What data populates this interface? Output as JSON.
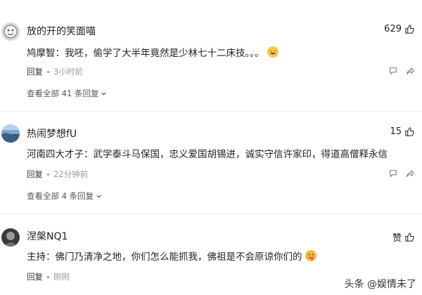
{
  "comments": [
    {
      "username": "放的开的笑面喵",
      "likes": "629",
      "text": "鸠摩智：我呸，偷学了大半年竟然是少林七十二床技。。。",
      "reply_label": "回复",
      "time": "3小时前",
      "view_all": "查看全部 41 条回复"
    },
    {
      "username": "热闹梦想fU",
      "likes": "15",
      "text": "河南四大才子：武学泰斗马保国，忠义爱国胡锡进，诚实守信许家印，得道高僧释永信",
      "reply_label": "回复",
      "time": "22分钟前",
      "view_all": "查看全部 4 条回复"
    },
    {
      "username": "涅槃NQ1",
      "likes": "赞",
      "text": "主持：佛门乃清净之地，你们怎么能抓我，佛祖是不会原谅你们的",
      "reply_label": "回复",
      "time": "刚刚"
    }
  ],
  "watermark": "头条 @娱情未了",
  "colors": {
    "text": "#222222",
    "muted": "#999999",
    "divider": "#ececec"
  }
}
